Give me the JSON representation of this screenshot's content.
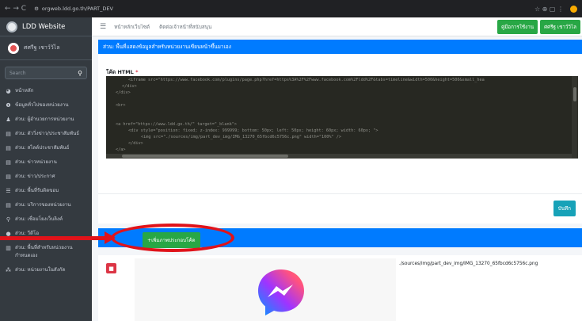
{
  "browser": {
    "url": "orgweb.ldd.go.th/PART_DEV",
    "nav_glyphs": "← → C",
    "right_glyphs": "☆ ⊕ ▢ ⋮"
  },
  "sidebar": {
    "brand": "LDD Website",
    "user": "ศศรีฐ เชาว์วิไล",
    "search_placeholder": "Search",
    "items": [
      {
        "icon": "dashboard-icon",
        "glyph": "◕",
        "label": "หน้าหลัก"
      },
      {
        "icon": "info-icon",
        "glyph": "❶",
        "label": "ข้อมูลทั่วไปของหน่วยงาน"
      },
      {
        "icon": "user-icon",
        "glyph": "♟",
        "label": "ส่วน: ผู้อำนวยการหน่วยงาน"
      },
      {
        "icon": "list-icon",
        "glyph": "▤",
        "label": "ส่วน: ตัววิ่งข่าว/ประชาสัมพันธ์"
      },
      {
        "icon": "list-icon",
        "glyph": "▤",
        "label": "ส่วน: สไลด์ประชาสัมพันธ์"
      },
      {
        "icon": "list-icon",
        "glyph": "▤",
        "label": "ส่วน: ข่าวหน่วยงาน"
      },
      {
        "icon": "list-icon",
        "glyph": "▤",
        "label": "ส่วน: ข่าว/ประกาศ"
      },
      {
        "icon": "menu-icon",
        "glyph": "☰",
        "label": "ส่วน: พื้นที่รับติดขอบ"
      },
      {
        "icon": "list-icon",
        "glyph": "▤",
        "label": "ส่วน: บริการของหน่วยงาน"
      },
      {
        "icon": "link-icon",
        "glyph": "⚲",
        "label": "ส่วน: เชื่อมโยงเว็บลิงค์"
      },
      {
        "icon": "video-icon",
        "glyph": "●",
        "label": "ส่วน: วีดีโอ"
      },
      {
        "icon": "book-icon",
        "glyph": "▥",
        "label": "ส่วน: พื้นที่สำหรับหน่วยงานกำหนดเอง"
      },
      {
        "icon": "sitemap-icon",
        "glyph": "⁂",
        "label": "ส่วน: หน่วยงานในสังกัด"
      }
    ]
  },
  "topnav": {
    "links": [
      "หน้าหลักเว็บไซต์",
      "ติดต่อเจ้าหน้าที่สนับสนุน"
    ],
    "manual_button": "คู่มือการใช้งาน",
    "user_button": "ศศรีฐ เชาว์วิไล"
  },
  "section": {
    "title": "ส่วน: พื้นที่แสดงข้อมูลสำหรับหน่วยงานเขียนหน้าขึ้นมาเอง",
    "code_label": "โค้ด HTML",
    "required_mark": "*",
    "code_lines": [
      "<iframe src=\"https://www.facebook.com/plugins/page.php?href=https%3A%2F%2Fwww.facebook.com%2Fldd%2F&tabs=timeline&width=500&height=500&small_hea",
      "</div>",
      "</div>",
      "",
      "<br>",
      "",
      "",
      "<a href=\"https://www.ldd.go.th/\" target=\"_blank\">",
      "<div style=\"position: fixed; z-index: 999999; bottom: 50px; left: 50px; height: 60px; width: 60px; \">",
      "<img src=\"./sources/img/part_dev_img/IMG_13270_65fbcd6c5756c.png\" width=\"100%\" />",
      "</div>",
      "</a>"
    ],
    "save_button": "บันทึก"
  },
  "image_section": {
    "add_button": "+เพิ่มภาพประกอบโค้ด",
    "image_path": "./sources/img/part_dev_img/IMG_13270_65fbcd6c5756c.png",
    "delete_glyph": "■"
  },
  "colors": {
    "accent_blue": "#007bff",
    "green": "#28a745",
    "danger": "#dc3545",
    "callout_red": "#e0131a",
    "messenger_gradient": [
      "#0099ff",
      "#a033ff",
      "#ff5280",
      "#ff7061"
    ]
  }
}
